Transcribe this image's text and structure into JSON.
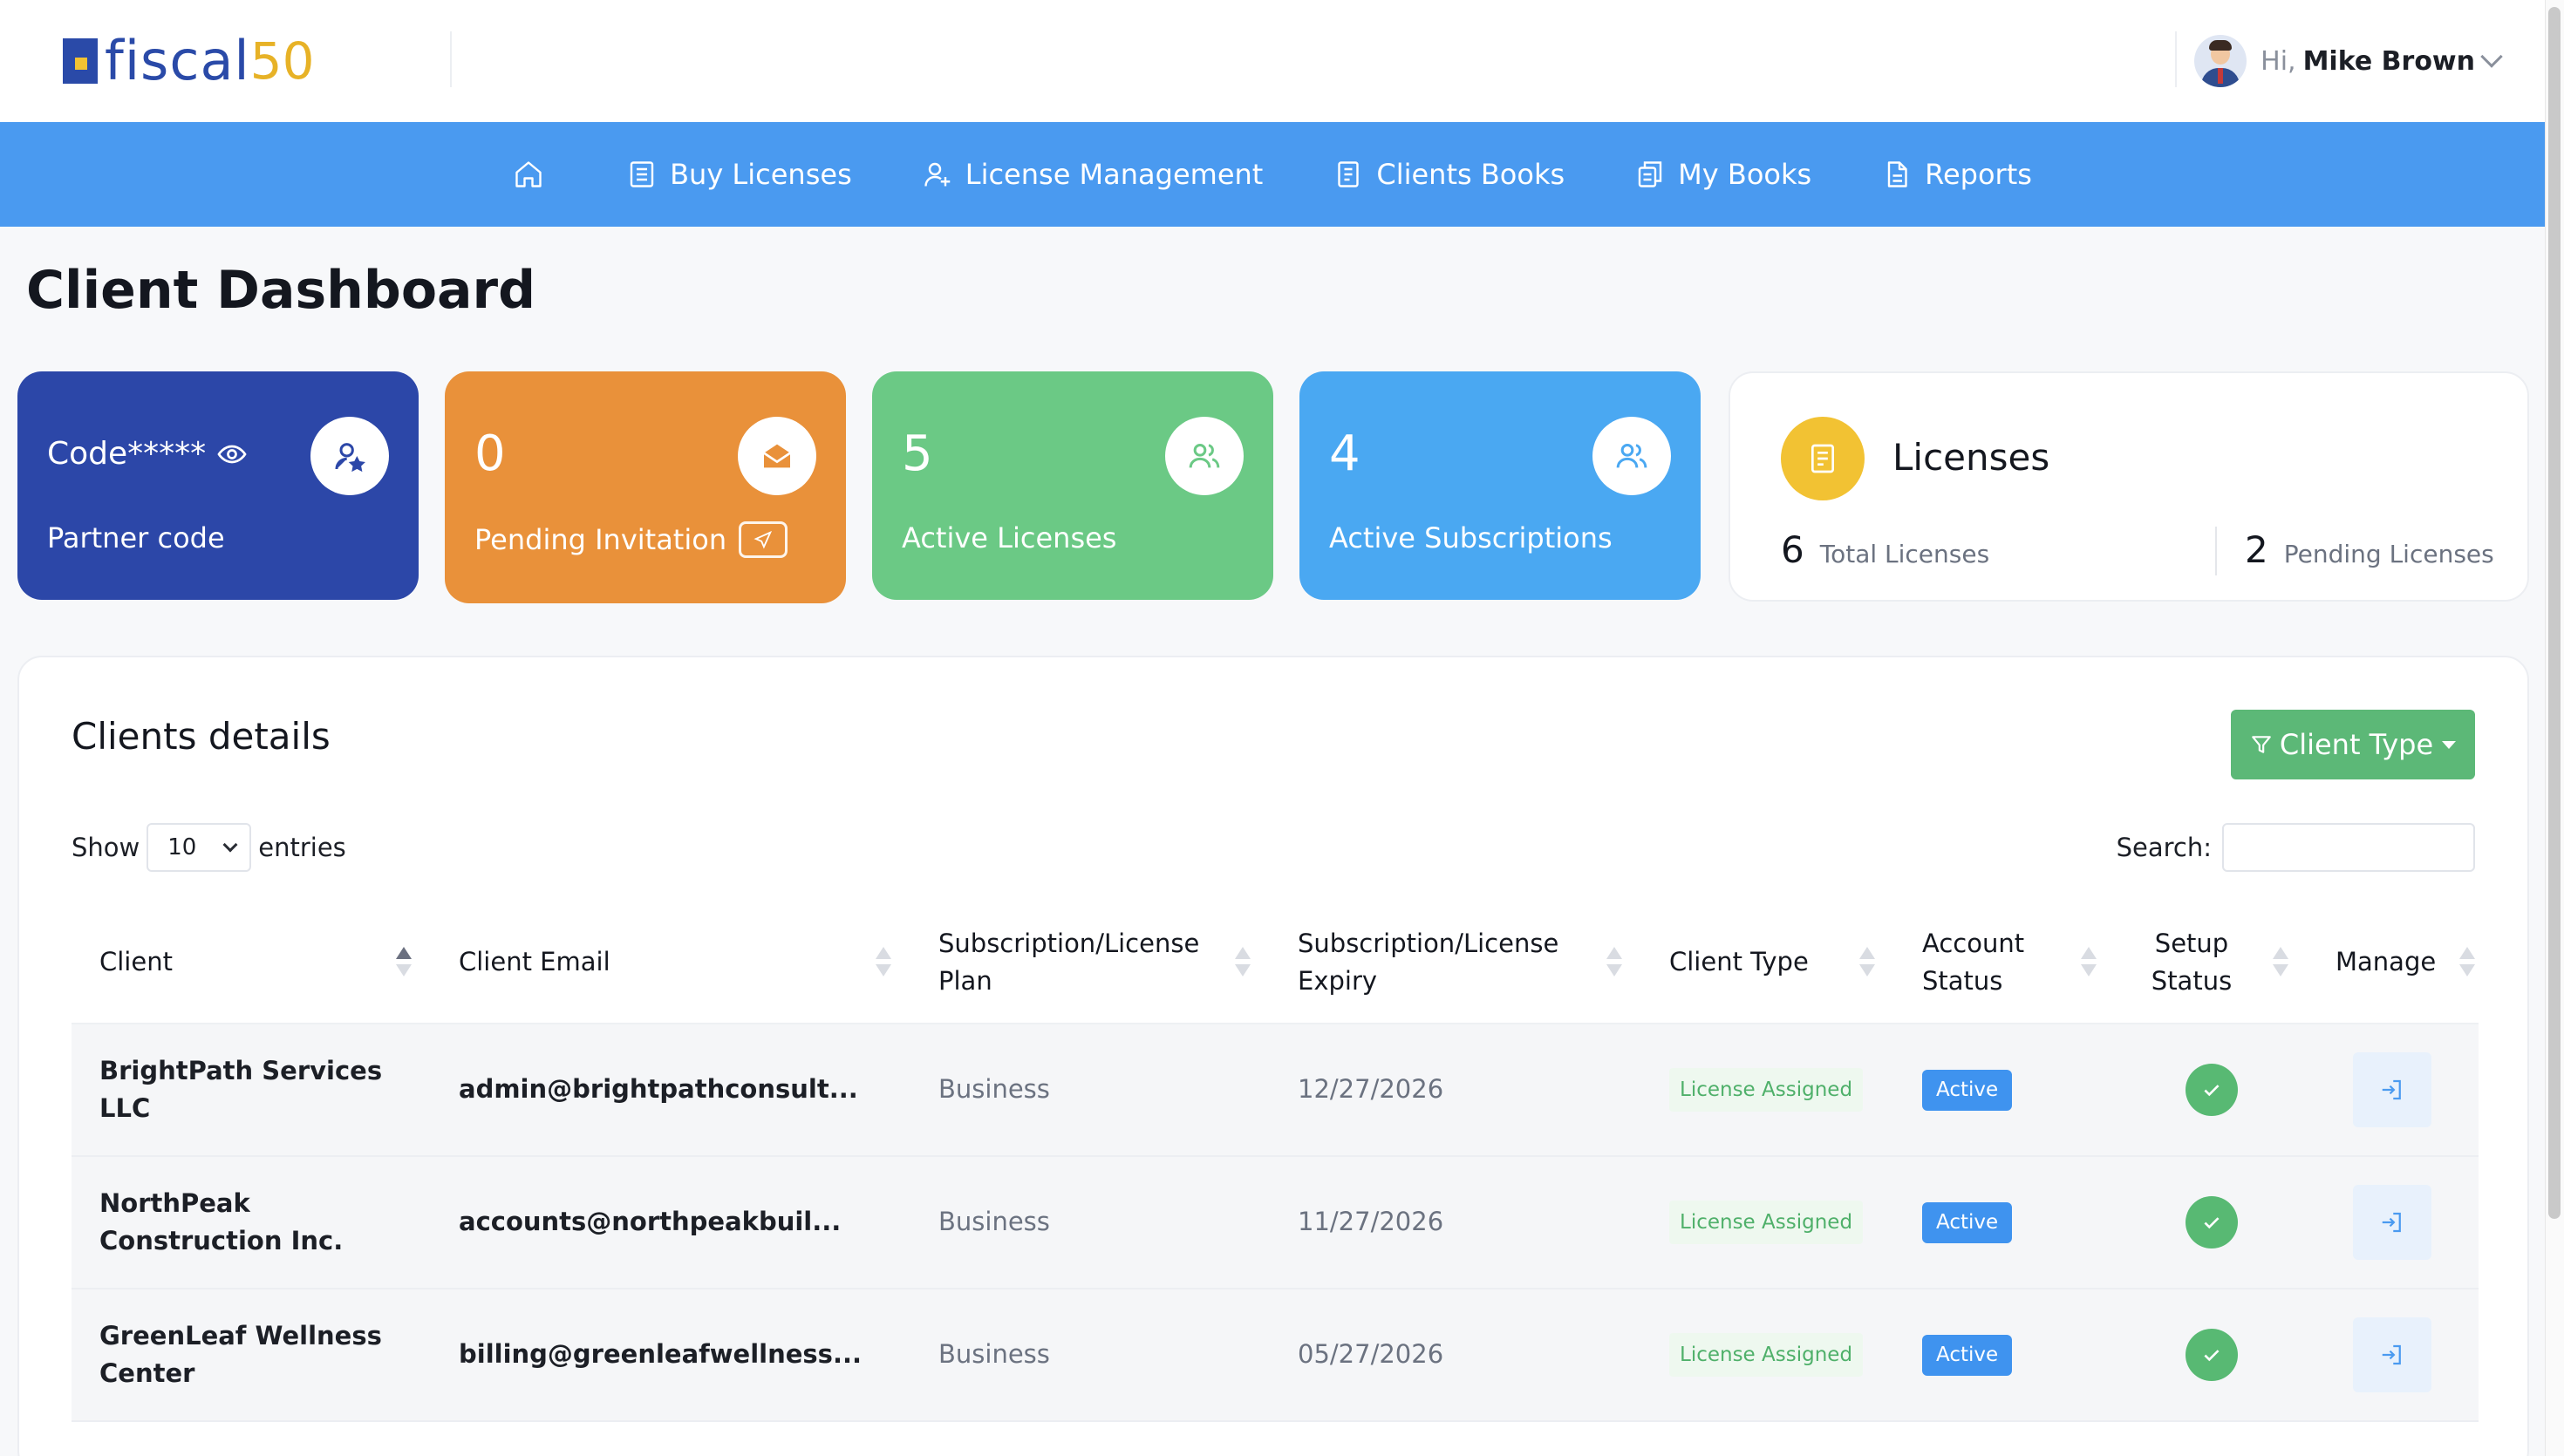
{
  "brand": {
    "name": "fiscal",
    "number": "50"
  },
  "user": {
    "greeting": "Hi,",
    "name": "Mike Brown"
  },
  "nav": {
    "items": [
      {
        "label": "",
        "icon": "home-icon"
      },
      {
        "label": "Buy Licenses",
        "icon": "list-icon"
      },
      {
        "label": "License Management",
        "icon": "user-plus-icon"
      },
      {
        "label": "Clients Books",
        "icon": "book-icon"
      },
      {
        "label": "My Books",
        "icon": "copy-icon"
      },
      {
        "label": "Reports",
        "icon": "file-icon"
      }
    ]
  },
  "page": {
    "title": "Client Dashboard"
  },
  "cards": {
    "partner": {
      "code": "Code*****",
      "label": "Partner code",
      "color": "#2c47a8"
    },
    "pending": {
      "value": "0",
      "label": "Pending Invitation",
      "color": "#e9913a"
    },
    "active_licenses": {
      "value": "5",
      "label": "Active Licenses",
      "color": "#6bc985"
    },
    "active_subscriptions": {
      "value": "4",
      "label": "Active Subscriptions",
      "color": "#4aa8f2"
    }
  },
  "licenses": {
    "title": "Licenses",
    "total_value": "6",
    "total_label": "Total Licenses",
    "pending_value": "2",
    "pending_label": "Pending Licenses"
  },
  "clients": {
    "title": "Clients details",
    "filter_label": "Client Type",
    "show_label": "Show",
    "entries_value": "10",
    "entries_label": "entries",
    "search_label": "Search:",
    "search_value": "",
    "columns": [
      "Client",
      "Client Email",
      "Subscription/License Plan",
      "Subscription/License Expiry",
      "Client Type",
      "Account Status",
      "Setup Status",
      "Manage"
    ],
    "rows": [
      {
        "client": "BrightPath Services LLC",
        "email": "admin@brightpathconsult...",
        "plan": "Business",
        "expiry": "12/27/2026",
        "type": "License Assigned",
        "status": "Active"
      },
      {
        "client": "NorthPeak Construction Inc.",
        "email": "accounts@northpeakbuil...",
        "plan": "Business",
        "expiry": "11/27/2026",
        "type": "License Assigned",
        "status": "Active"
      },
      {
        "client": "GreenLeaf Wellness Center",
        "email": "billing@greenleafwellness...",
        "plan": "Business",
        "expiry": "05/27/2026",
        "type": "License Assigned",
        "status": "Active"
      }
    ]
  },
  "colors": {
    "nav_bar": "#4a9af0",
    "accent_green": "#5cb877",
    "brand_blue": "#2a4aa8",
    "brand_gold": "#e7b227"
  }
}
